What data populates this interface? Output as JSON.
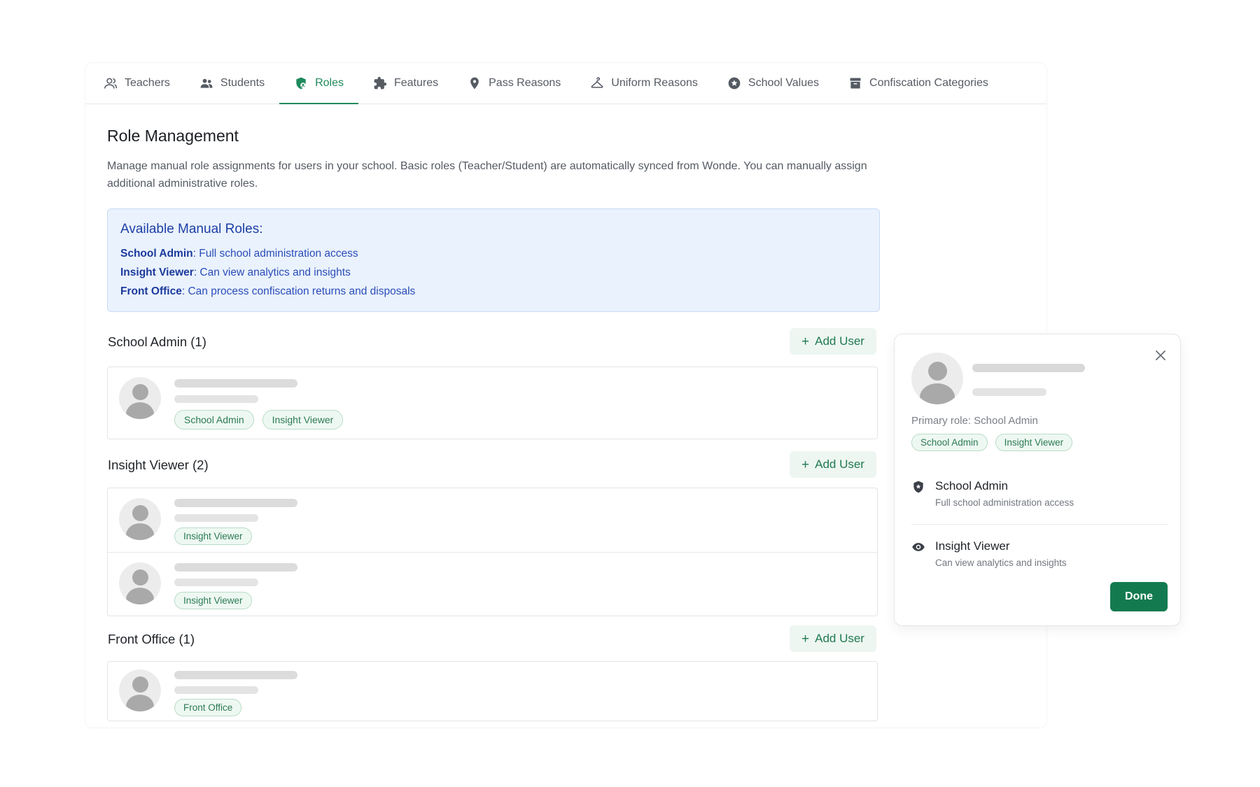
{
  "tabs": [
    {
      "label": "Teachers",
      "icon": "person-outline-icon"
    },
    {
      "label": "Students",
      "icon": "people-icon"
    },
    {
      "label": "Roles",
      "icon": "shield-user-icon",
      "active": true
    },
    {
      "label": "Features",
      "icon": "puzzle-icon"
    },
    {
      "label": "Pass Reasons",
      "icon": "location-pin-icon"
    },
    {
      "label": "Uniform Reasons",
      "icon": "hanger-icon"
    },
    {
      "label": "School Values",
      "icon": "star-circle-icon"
    },
    {
      "label": "Confiscation Categories",
      "icon": "archive-box-icon"
    }
  ],
  "page": {
    "title": "Role Management",
    "description": "Manage manual role assignments for users in your school. Basic roles (Teacher/Student) are automatically synced from Wonde. You can manually assign additional administrative roles."
  },
  "info_box": {
    "heading": "Available Manual Roles:",
    "roles": [
      {
        "name": "School Admin",
        "desc": ": Full school administration access"
      },
      {
        "name": "Insight Viewer",
        "desc": ": Can view analytics and insights"
      },
      {
        "name": "Front Office",
        "desc": ": Can process confiscation returns and disposals"
      }
    ]
  },
  "add_user_label": "Add User",
  "sections": {
    "school_admin": {
      "title": "School Admin (1)",
      "badges": [
        "School Admin",
        "Insight Viewer"
      ]
    },
    "insight_viewer": {
      "title": "Insight Viewer (2)",
      "badge": "Insight Viewer"
    },
    "front_office": {
      "title": "Front Office (1)",
      "badge": "Front Office"
    }
  },
  "popup": {
    "primary_role": "Primary role: School Admin",
    "badges": [
      "School Admin",
      "Insight Viewer"
    ],
    "roles": [
      {
        "name": "School Admin",
        "desc": "Full school administration access",
        "icon": "shield-icon"
      },
      {
        "name": "Insight Viewer",
        "desc": "Can view analytics and insights",
        "icon": "eye-icon"
      }
    ],
    "done_label": "Done"
  },
  "colors": {
    "accent": "#1f8a5b",
    "done_button": "#137a4f",
    "info_bg": "#eaf2fd",
    "info_text": "#2a4db8"
  }
}
